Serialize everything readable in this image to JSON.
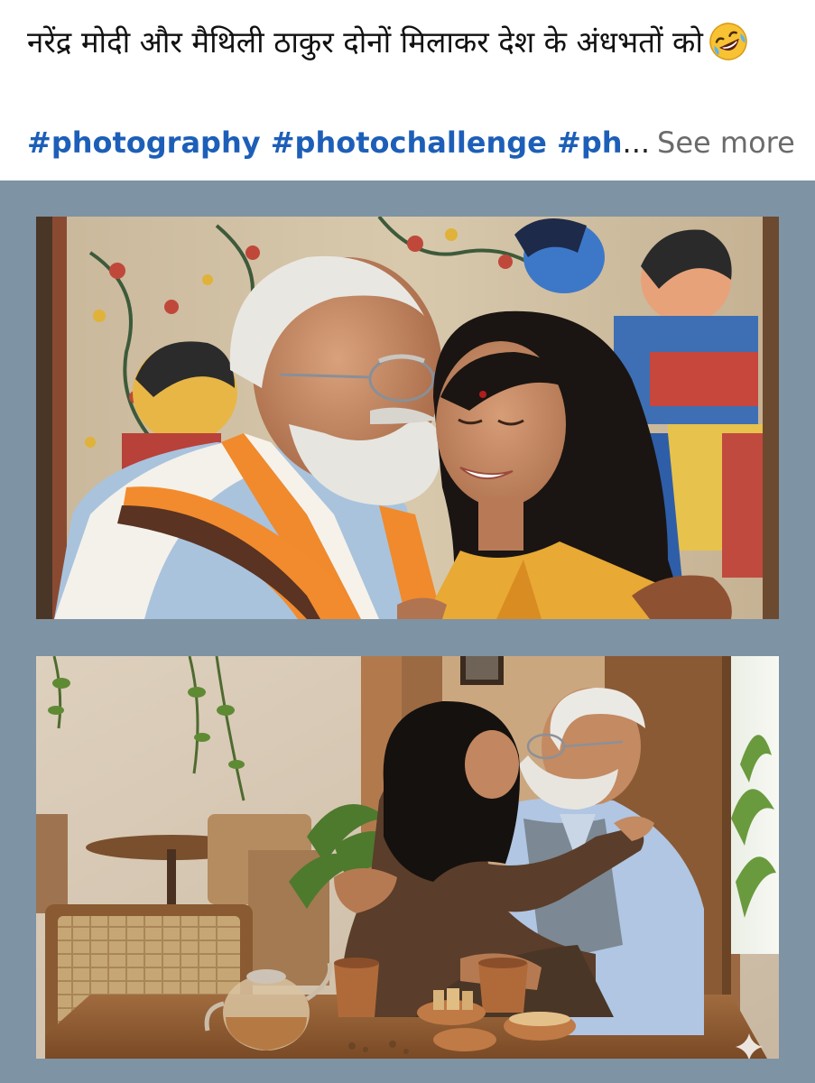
{
  "post": {
    "caption": "नरेंद्र मोदी और मैथिली ठाकुर दोनों मिलाकर देश के अंधभतों को",
    "emoji": "rolling-on-floor-laughing",
    "hashtags": "#photography #photochallenge #ph",
    "ellipsis": "...",
    "see_more": "See more"
  },
  "media": {
    "background_color": "#7e93a4",
    "images": [
      {
        "name": "photo-1"
      },
      {
        "name": "photo-2"
      }
    ]
  }
}
